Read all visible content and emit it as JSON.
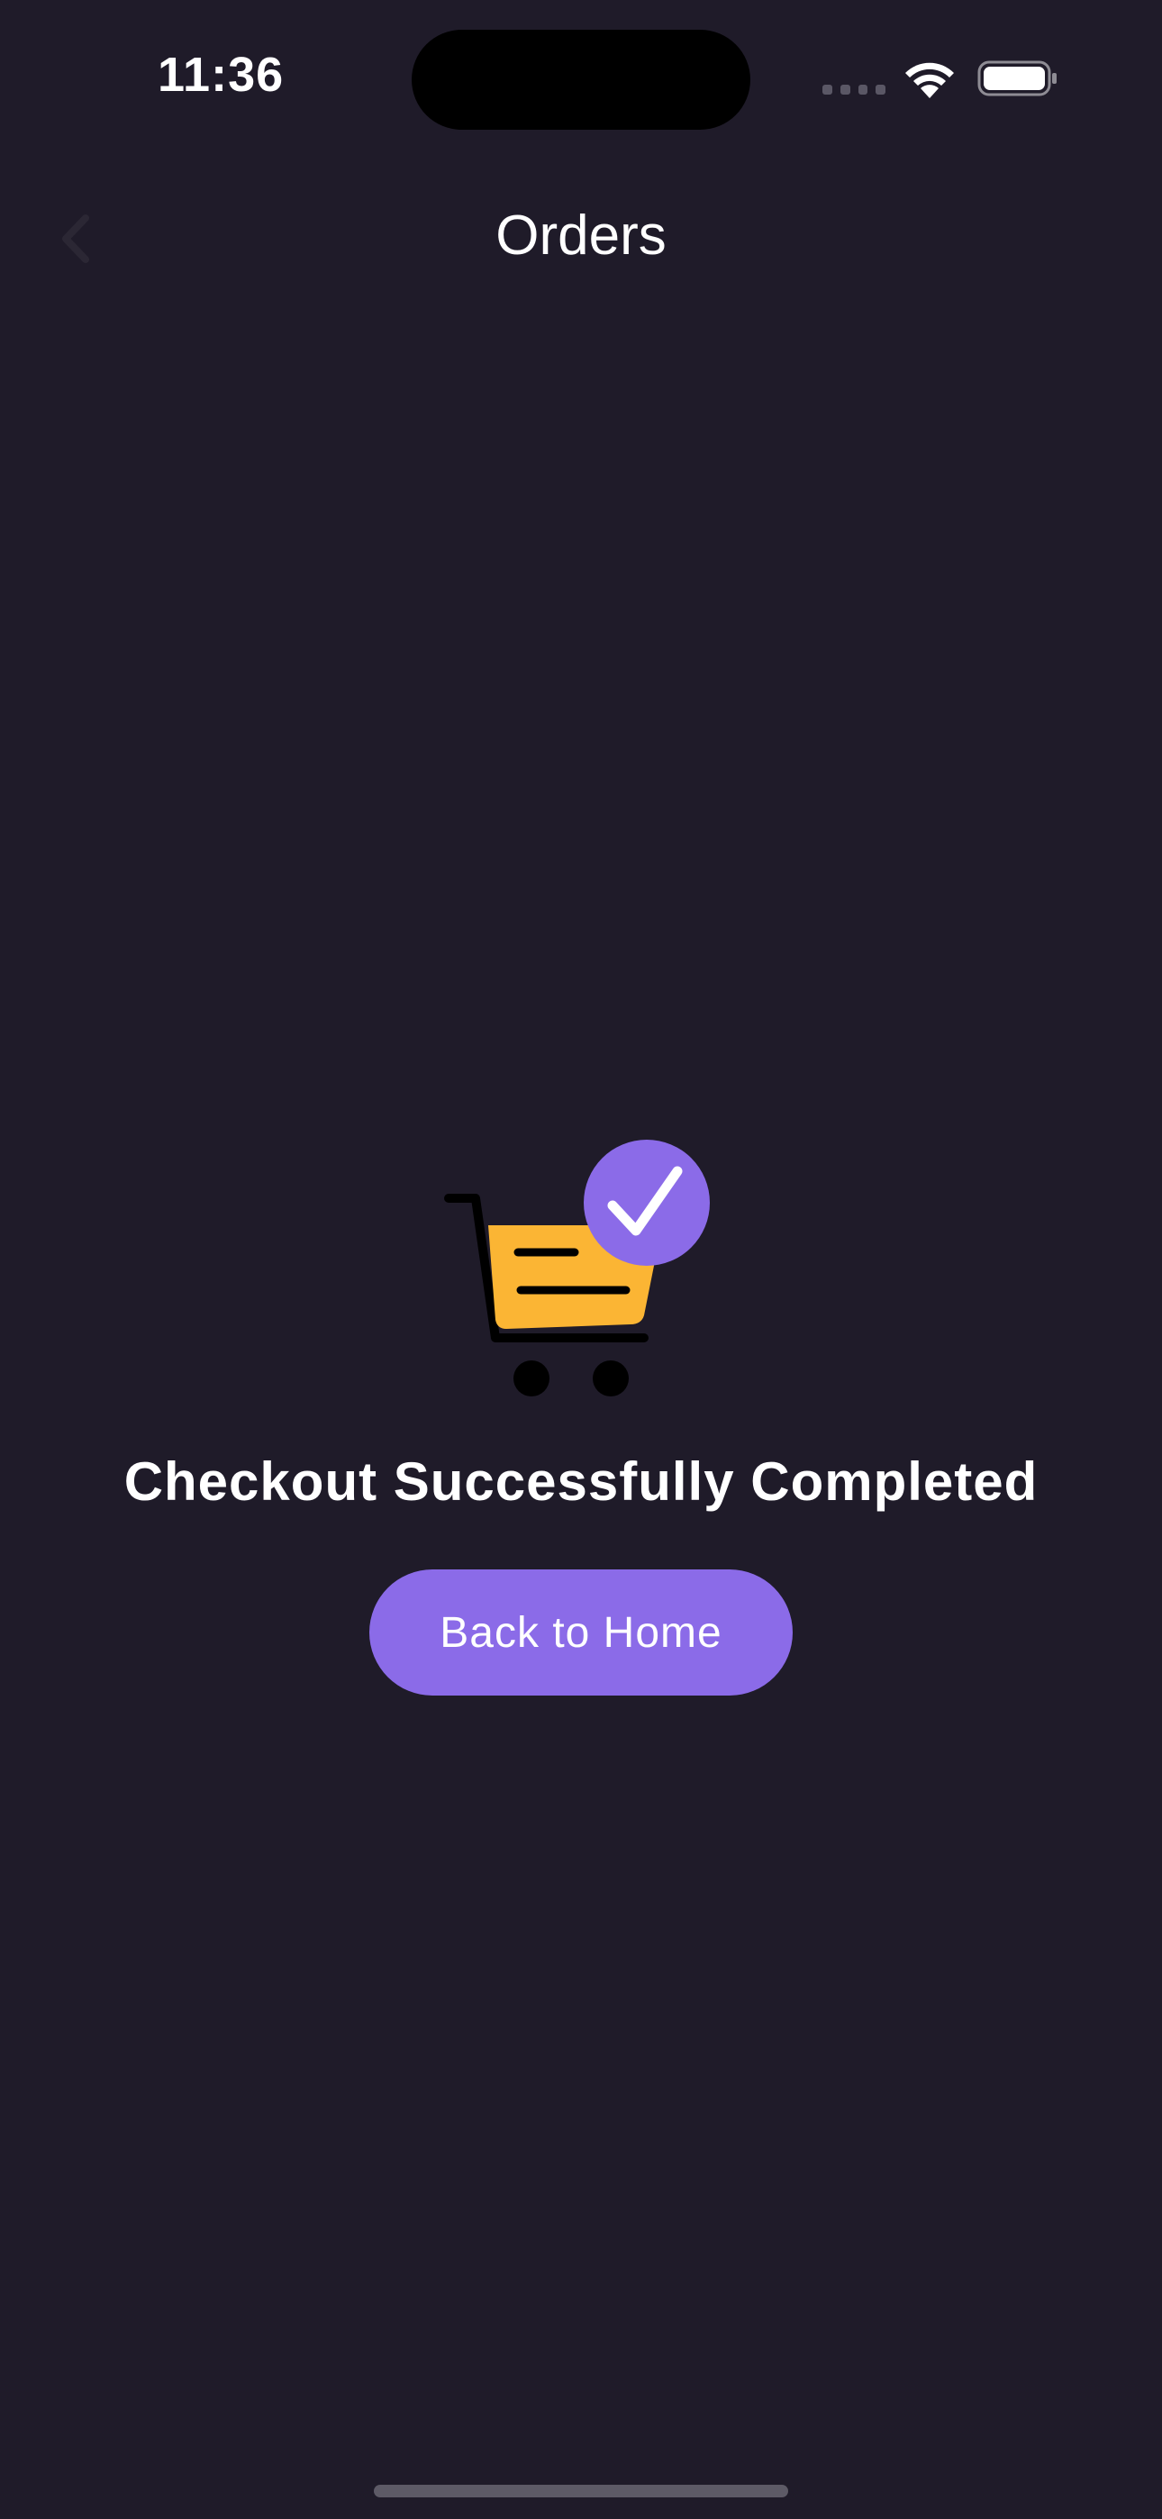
{
  "status_bar": {
    "time": "11:36",
    "icons": [
      "signal-dots-icon",
      "wifi-icon",
      "battery-icon"
    ]
  },
  "nav": {
    "title": "Orders",
    "back_icon": "chevron-left-icon"
  },
  "main": {
    "illustration": "cart-checkmark-icon",
    "title": "Checkout Successfully Completed",
    "button_label": "Back to Home"
  },
  "colors": {
    "background": "#1f1b29",
    "accent": "#8b6be8",
    "cart_fill": "#fbb534"
  }
}
